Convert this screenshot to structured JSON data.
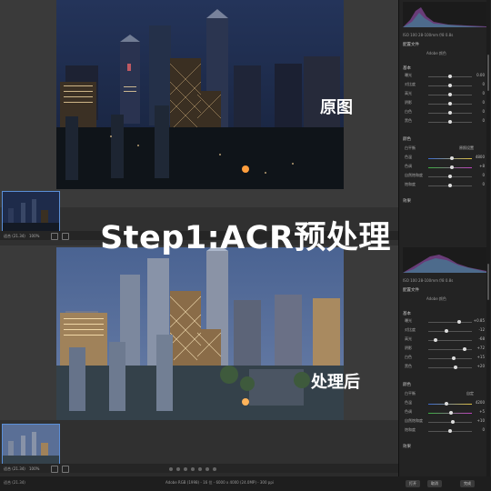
{
  "overlay": {
    "title": "Step1:ACR预处理",
    "before_label": "原图",
    "after_label": "处理后"
  },
  "before_panel": {
    "camera_info": "ISO 100  28-100mm  f/8  0.8s",
    "profile_label": "配置文件",
    "profile_value": "Adobe 颜色",
    "section_basic": "基本",
    "sliders": [
      {
        "label": "曝光",
        "value": "0.00"
      },
      {
        "label": "对比度",
        "value": "0"
      },
      {
        "label": "高光",
        "value": "0"
      },
      {
        "label": "阴影",
        "value": "0"
      },
      {
        "label": "白色",
        "value": "0"
      },
      {
        "label": "黑色",
        "value": "0"
      }
    ],
    "section_color": "颜色",
    "wb_label": "白平衡",
    "wb_value": "原照设置",
    "color_sliders": [
      {
        "label": "色温",
        "value": "4800"
      },
      {
        "label": "色调",
        "value": "+8"
      },
      {
        "label": "自然饱和度",
        "value": "0"
      },
      {
        "label": "饱和度",
        "value": "0"
      }
    ],
    "section_effects": "效果",
    "zoom": "适合 (21.34)",
    "zoom_pct": "100%"
  },
  "after_panel": {
    "camera_info": "ISO 100  28-100mm  f/8  0.8s",
    "profile_label": "配置文件",
    "profile_value": "Adobe 颜色",
    "section_basic": "基本",
    "sliders": [
      {
        "label": "曝光",
        "value": "+0.85"
      },
      {
        "label": "对比度",
        "value": "-12"
      },
      {
        "label": "高光",
        "value": "-68"
      },
      {
        "label": "阴影",
        "value": "+72"
      },
      {
        "label": "白色",
        "value": "+15"
      },
      {
        "label": "黑色",
        "value": "+20"
      }
    ],
    "section_color": "颜色",
    "wb_label": "白平衡",
    "wb_value": "自定",
    "color_sliders": [
      {
        "label": "色温",
        "value": "4200"
      },
      {
        "label": "色调",
        "value": "+5"
      },
      {
        "label": "自然饱和度",
        "value": "+10"
      },
      {
        "label": "饱和度",
        "value": "0"
      }
    ],
    "section_effects": "效果",
    "zoom": "适合 (21.34)",
    "zoom_pct": "100%"
  },
  "status": {
    "left": "适合 (21.34)",
    "center": "Adobe RGB (1998) - 16 位 - 6000 x 4000 (24.0MP) - 300 ppi",
    "open": "打开",
    "done": "完成",
    "cancel": "取消"
  },
  "colors": {
    "accent": "#5a8fd8",
    "sky_before": "#1c2a4a",
    "sky_after": "#4a6390"
  }
}
